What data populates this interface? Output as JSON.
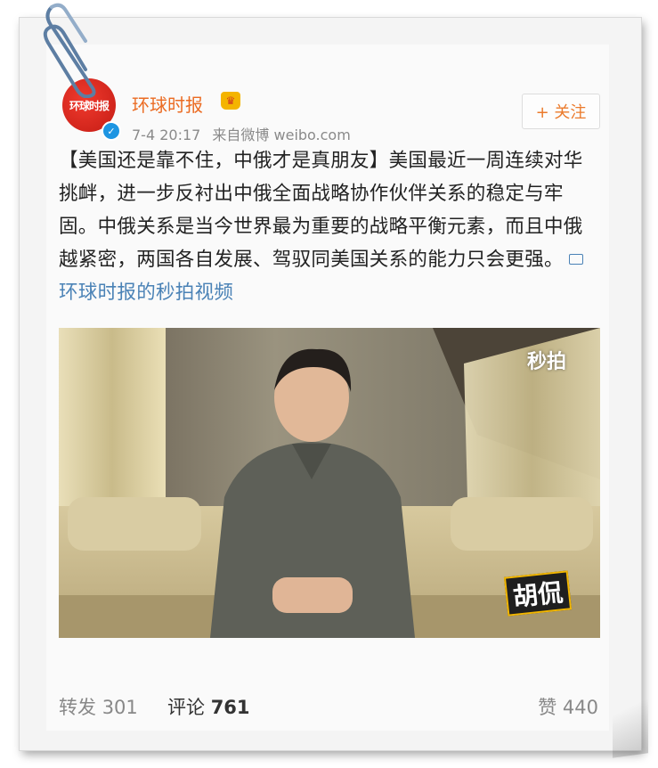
{
  "post": {
    "account_name": "环球时报",
    "avatar_text": "环球时报",
    "timestamp": "7-4 20:17",
    "source": "来自微博 weibo.com",
    "follow_label": "+ 关注",
    "text": "【美国还是靠不住，中俄才是真朋友】美国最近一周连续对华挑衅，进一步反衬出中俄全面战略协作伙伴关系的稳定与牢固。中俄关系是当今世界最为重要的战略平衡元素，而且中俄越紧密，两国各自发展、驾驭同美国关系的能力只会更强。",
    "video_link": "环球时报的秒拍视频"
  },
  "video": {
    "watermark": "秒拍",
    "badge": "胡侃"
  },
  "stats": {
    "reposts_label": "转发",
    "reposts": "301",
    "comments_label": "评论",
    "comments": "761",
    "likes_label": "赞",
    "likes": "440"
  },
  "colors": {
    "name": "#eb6b22",
    "link": "#4a82b6",
    "avatar": "#d62a20"
  }
}
